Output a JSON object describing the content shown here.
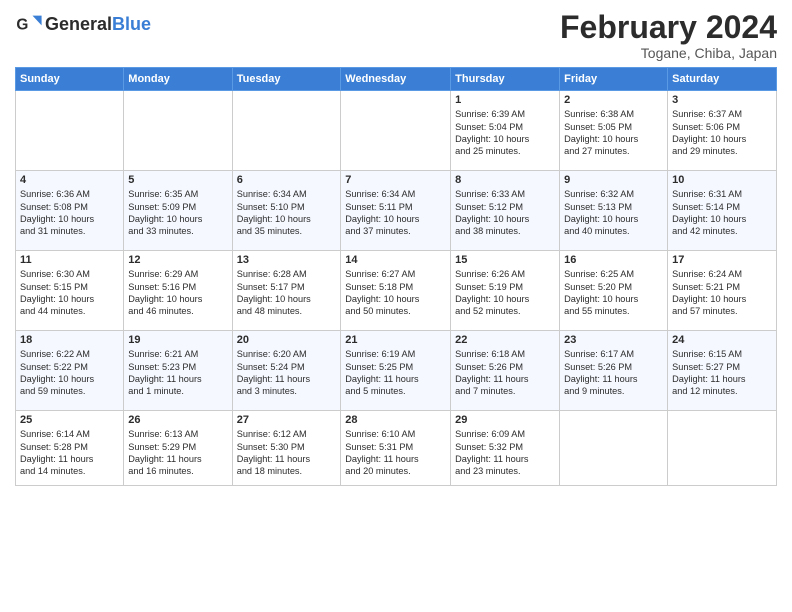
{
  "header": {
    "logo_general": "General",
    "logo_blue": "Blue",
    "month": "February 2024",
    "location": "Togane, Chiba, Japan"
  },
  "days_of_week": [
    "Sunday",
    "Monday",
    "Tuesday",
    "Wednesday",
    "Thursday",
    "Friday",
    "Saturday"
  ],
  "weeks": [
    [
      {
        "day": "",
        "info": ""
      },
      {
        "day": "",
        "info": ""
      },
      {
        "day": "",
        "info": ""
      },
      {
        "day": "",
        "info": ""
      },
      {
        "day": "1",
        "info": "Sunrise: 6:39 AM\nSunset: 5:04 PM\nDaylight: 10 hours\nand 25 minutes."
      },
      {
        "day": "2",
        "info": "Sunrise: 6:38 AM\nSunset: 5:05 PM\nDaylight: 10 hours\nand 27 minutes."
      },
      {
        "day": "3",
        "info": "Sunrise: 6:37 AM\nSunset: 5:06 PM\nDaylight: 10 hours\nand 29 minutes."
      }
    ],
    [
      {
        "day": "4",
        "info": "Sunrise: 6:36 AM\nSunset: 5:08 PM\nDaylight: 10 hours\nand 31 minutes."
      },
      {
        "day": "5",
        "info": "Sunrise: 6:35 AM\nSunset: 5:09 PM\nDaylight: 10 hours\nand 33 minutes."
      },
      {
        "day": "6",
        "info": "Sunrise: 6:34 AM\nSunset: 5:10 PM\nDaylight: 10 hours\nand 35 minutes."
      },
      {
        "day": "7",
        "info": "Sunrise: 6:34 AM\nSunset: 5:11 PM\nDaylight: 10 hours\nand 37 minutes."
      },
      {
        "day": "8",
        "info": "Sunrise: 6:33 AM\nSunset: 5:12 PM\nDaylight: 10 hours\nand 38 minutes."
      },
      {
        "day": "9",
        "info": "Sunrise: 6:32 AM\nSunset: 5:13 PM\nDaylight: 10 hours\nand 40 minutes."
      },
      {
        "day": "10",
        "info": "Sunrise: 6:31 AM\nSunset: 5:14 PM\nDaylight: 10 hours\nand 42 minutes."
      }
    ],
    [
      {
        "day": "11",
        "info": "Sunrise: 6:30 AM\nSunset: 5:15 PM\nDaylight: 10 hours\nand 44 minutes."
      },
      {
        "day": "12",
        "info": "Sunrise: 6:29 AM\nSunset: 5:16 PM\nDaylight: 10 hours\nand 46 minutes."
      },
      {
        "day": "13",
        "info": "Sunrise: 6:28 AM\nSunset: 5:17 PM\nDaylight: 10 hours\nand 48 minutes."
      },
      {
        "day": "14",
        "info": "Sunrise: 6:27 AM\nSunset: 5:18 PM\nDaylight: 10 hours\nand 50 minutes."
      },
      {
        "day": "15",
        "info": "Sunrise: 6:26 AM\nSunset: 5:19 PM\nDaylight: 10 hours\nand 52 minutes."
      },
      {
        "day": "16",
        "info": "Sunrise: 6:25 AM\nSunset: 5:20 PM\nDaylight: 10 hours\nand 55 minutes."
      },
      {
        "day": "17",
        "info": "Sunrise: 6:24 AM\nSunset: 5:21 PM\nDaylight: 10 hours\nand 57 minutes."
      }
    ],
    [
      {
        "day": "18",
        "info": "Sunrise: 6:22 AM\nSunset: 5:22 PM\nDaylight: 10 hours\nand 59 minutes."
      },
      {
        "day": "19",
        "info": "Sunrise: 6:21 AM\nSunset: 5:23 PM\nDaylight: 11 hours\nand 1 minute."
      },
      {
        "day": "20",
        "info": "Sunrise: 6:20 AM\nSunset: 5:24 PM\nDaylight: 11 hours\nand 3 minutes."
      },
      {
        "day": "21",
        "info": "Sunrise: 6:19 AM\nSunset: 5:25 PM\nDaylight: 11 hours\nand 5 minutes."
      },
      {
        "day": "22",
        "info": "Sunrise: 6:18 AM\nSunset: 5:26 PM\nDaylight: 11 hours\nand 7 minutes."
      },
      {
        "day": "23",
        "info": "Sunrise: 6:17 AM\nSunset: 5:26 PM\nDaylight: 11 hours\nand 9 minutes."
      },
      {
        "day": "24",
        "info": "Sunrise: 6:15 AM\nSunset: 5:27 PM\nDaylight: 11 hours\nand 12 minutes."
      }
    ],
    [
      {
        "day": "25",
        "info": "Sunrise: 6:14 AM\nSunset: 5:28 PM\nDaylight: 11 hours\nand 14 minutes."
      },
      {
        "day": "26",
        "info": "Sunrise: 6:13 AM\nSunset: 5:29 PM\nDaylight: 11 hours\nand 16 minutes."
      },
      {
        "day": "27",
        "info": "Sunrise: 6:12 AM\nSunset: 5:30 PM\nDaylight: 11 hours\nand 18 minutes."
      },
      {
        "day": "28",
        "info": "Sunrise: 6:10 AM\nSunset: 5:31 PM\nDaylight: 11 hours\nand 20 minutes."
      },
      {
        "day": "29",
        "info": "Sunrise: 6:09 AM\nSunset: 5:32 PM\nDaylight: 11 hours\nand 23 minutes."
      },
      {
        "day": "",
        "info": ""
      },
      {
        "day": "",
        "info": ""
      }
    ]
  ]
}
